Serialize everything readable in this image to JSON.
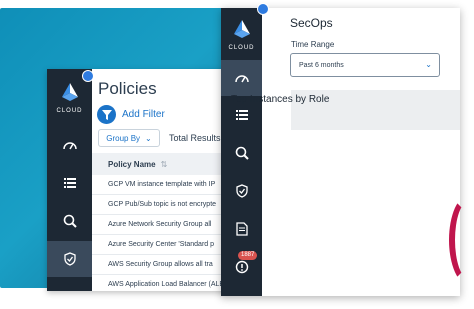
{
  "back_window": {
    "logo_text": "CLOUD",
    "title": "Policies",
    "add_filter_label": "Add Filter",
    "group_by_label": "Group By",
    "total_results_label": "Total Results:",
    "table": {
      "column_header": "Policy Name",
      "rows": [
        "GCP VM instance template with IP",
        "GCP Pub/Sub topic is not encrypte",
        "Azure Network Security Group all",
        "Azure Security Center 'Standard p",
        "AWS Security Group allows all tra",
        "AWS Application Load Balancer (ALB"
      ]
    },
    "sidebar_icons": [
      "cloud-logo-icon",
      "dashboard-gauge-icon",
      "list-icon",
      "search-icon",
      "shield-check-icon"
    ]
  },
  "front_window": {
    "logo_text": "CLOUD",
    "section_title": "SecOps",
    "time_range_label": "Time Range",
    "time_range_value": "Past 6 months",
    "panel_title": "Top Instances by Role",
    "alert_badge": "1887",
    "sidebar_icons": [
      "cloud-logo-icon",
      "dashboard-gauge-icon",
      "list-icon",
      "search-icon",
      "shield-check-icon",
      "document-icon",
      "alert-icon"
    ]
  },
  "colors": {
    "sidebar_bg": "#1d2834",
    "accent_blue": "#1b73c8",
    "badge_red": "#d9534f",
    "background_gradient": "#0f8fb8"
  }
}
